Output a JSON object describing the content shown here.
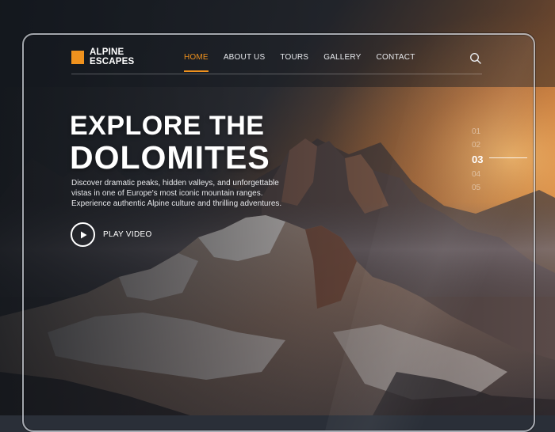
{
  "brand": {
    "name_line1": "ALPINE",
    "name_line2": "ESCAPES",
    "accent_color": "#f0921e"
  },
  "nav": {
    "items": [
      {
        "label": "HOME",
        "active": true
      },
      {
        "label": "ABOUT US",
        "active": false
      },
      {
        "label": "TOURS",
        "active": false
      },
      {
        "label": "GALLERY",
        "active": false
      },
      {
        "label": "CONTACT",
        "active": false
      }
    ],
    "search_icon": "search-icon"
  },
  "hero": {
    "title_line1": "EXPLORE THE",
    "title_line2": "DOLOMITES",
    "description": "Discover dramatic peaks, hidden valleys, and unforgettable vistas in one of Europe's most iconic mountain ranges. Experience authentic Alpine culture and thrilling adventures.",
    "cta_label": "PLAY VIDEO",
    "cta_icon": "play-icon"
  },
  "pager": {
    "items": [
      "01",
      "02",
      "03",
      "04",
      "05"
    ],
    "active_index": 2
  }
}
